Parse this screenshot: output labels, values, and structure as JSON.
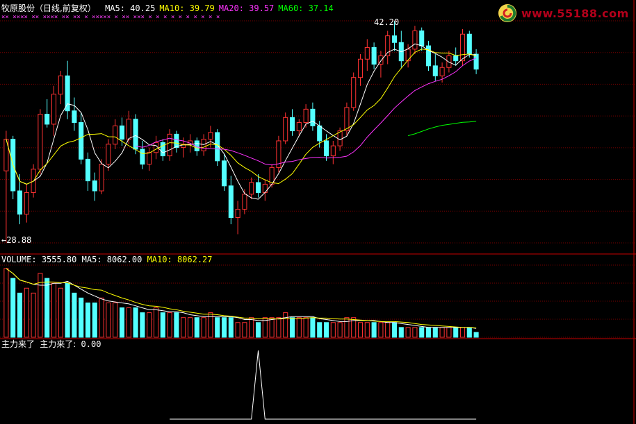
{
  "header": {
    "title": "牧原股份（日线,前复权）",
    "ma_items": [
      {
        "label": "MA5:",
        "value": "40.25",
        "color": "#ffffff"
      },
      {
        "label": "MA10:",
        "value": "39.79",
        "color": "#ffff00"
      },
      {
        "label": "MA20:",
        "value": "39.57",
        "color": "#ff33ff"
      },
      {
        "label": "MA60:",
        "value": "37.14",
        "color": "#00ff00"
      }
    ]
  },
  "logo": {
    "text": "www.55188.com"
  },
  "price_panel": {
    "high_marker": "42.20",
    "low_marker": "28.88",
    "x_markers": "××  ××××    ××  ××××      ××    ××    ×   ×××××    ×   ××  ×××  ×   ×    ×   ×   ×  ×   ×   ×   ×   ×"
  },
  "volume_panel": {
    "label": "VOLUME:",
    "value": "3555.80",
    "ma5_label": "MA5:",
    "ma5_value": "8062.00",
    "ma10_label": "MA10:",
    "ma10_value": "8062.27"
  },
  "indicator_panel": {
    "label": "主力来了",
    "line_label": "主力来了:",
    "value": "0.00"
  },
  "colors": {
    "up": "#ff3232",
    "down": "#54ffff",
    "grid": "#7a0000",
    "divider": "#c80000",
    "ma5": "#ffffff",
    "ma10": "#ffff00",
    "ma20": "#ff33ff",
    "ma60": "#00ff00"
  },
  "chart_data": {
    "type": "candlestick",
    "y_range": [
      28.88,
      42.2
    ],
    "ohlc": [
      [
        33.2,
        35.6,
        28.9,
        35.1
      ],
      [
        35.1,
        35.3,
        31.5,
        32.0
      ],
      [
        32.0,
        33.0,
        30.0,
        30.6
      ],
      [
        30.6,
        32.4,
        30.1,
        31.9
      ],
      [
        31.9,
        33.6,
        31.6,
        33.3
      ],
      [
        33.3,
        36.9,
        33.0,
        36.6
      ],
      [
        36.6,
        37.5,
        35.8,
        36.0
      ],
      [
        36.0,
        38.3,
        35.3,
        37.8
      ],
      [
        37.8,
        39.2,
        37.2,
        38.9
      ],
      [
        38.9,
        39.8,
        36.3,
        36.8
      ],
      [
        36.8,
        37.6,
        35.6,
        36.1
      ],
      [
        36.1,
        36.7,
        33.6,
        33.9
      ],
      [
        33.9,
        34.3,
        32.0,
        32.6
      ],
      [
        32.6,
        33.1,
        31.4,
        32.0
      ],
      [
        32.0,
        33.9,
        31.8,
        33.6
      ],
      [
        33.6,
        35.1,
        33.2,
        34.8
      ],
      [
        34.8,
        36.3,
        34.5,
        35.9
      ],
      [
        35.9,
        36.4,
        34.7,
        35.1
      ],
      [
        35.1,
        36.8,
        34.8,
        36.3
      ],
      [
        36.3,
        36.6,
        34.2,
        34.5
      ],
      [
        34.5,
        35.0,
        33.3,
        33.6
      ],
      [
        33.6,
        34.6,
        33.2,
        34.3
      ],
      [
        34.3,
        35.3,
        33.9,
        34.9
      ],
      [
        34.9,
        35.1,
        33.8,
        34.1
      ],
      [
        34.1,
        35.7,
        33.8,
        35.4
      ],
      [
        35.4,
        35.6,
        34.3,
        34.6
      ],
      [
        34.6,
        35.2,
        34.0,
        34.8
      ],
      [
        34.8,
        35.4,
        34.3,
        35.0
      ],
      [
        35.0,
        35.2,
        34.1,
        34.4
      ],
      [
        34.4,
        35.4,
        34.1,
        35.1
      ],
      [
        35.1,
        35.9,
        34.6,
        35.5
      ],
      [
        35.5,
        35.7,
        33.5,
        33.8
      ],
      [
        33.8,
        34.2,
        32.0,
        32.3
      ],
      [
        32.3,
        32.9,
        30.0,
        30.4
      ],
      [
        30.4,
        31.4,
        29.4,
        30.9
      ],
      [
        30.9,
        32.1,
        30.6,
        31.8
      ],
      [
        31.8,
        32.8,
        31.5,
        32.5
      ],
      [
        32.5,
        33.0,
        31.6,
        31.9
      ],
      [
        31.9,
        32.7,
        31.4,
        32.4
      ],
      [
        32.4,
        33.6,
        32.2,
        33.4
      ],
      [
        33.4,
        35.3,
        33.1,
        35.0
      ],
      [
        35.0,
        36.7,
        34.8,
        36.4
      ],
      [
        36.4,
        36.9,
        35.3,
        35.6
      ],
      [
        35.6,
        36.3,
        35.3,
        36.1
      ],
      [
        36.1,
        37.2,
        35.8,
        36.9
      ],
      [
        36.9,
        37.3,
        35.6,
        35.9
      ],
      [
        35.9,
        36.2,
        34.6,
        35.0
      ],
      [
        35.0,
        35.4,
        33.8,
        34.1
      ],
      [
        34.1,
        35.0,
        33.6,
        34.7
      ],
      [
        34.7,
        35.8,
        34.4,
        35.6
      ],
      [
        35.6,
        37.3,
        35.3,
        37.0
      ],
      [
        37.0,
        39.1,
        36.8,
        38.8
      ],
      [
        38.8,
        40.2,
        38.3,
        39.9
      ],
      [
        39.9,
        41.1,
        39.2,
        40.6
      ],
      [
        40.6,
        40.9,
        39.3,
        39.6
      ],
      [
        39.6,
        40.4,
        38.8,
        40.1
      ],
      [
        40.1,
        41.6,
        39.6,
        41.3
      ],
      [
        41.3,
        42.2,
        40.4,
        40.9
      ],
      [
        40.9,
        41.6,
        39.4,
        39.8
      ],
      [
        39.8,
        40.8,
        39.4,
        40.5
      ],
      [
        40.5,
        41.9,
        40.2,
        41.6
      ],
      [
        41.6,
        41.8,
        40.4,
        40.7
      ],
      [
        40.7,
        41.0,
        39.2,
        39.5
      ],
      [
        39.5,
        40.2,
        38.6,
        38.9
      ],
      [
        38.9,
        39.7,
        38.5,
        39.4
      ],
      [
        39.4,
        40.4,
        39.1,
        40.1
      ],
      [
        40.1,
        40.6,
        39.5,
        39.8
      ],
      [
        39.8,
        41.7,
        39.5,
        41.4
      ],
      [
        41.4,
        41.6,
        40.0,
        40.2
      ],
      [
        40.2,
        40.5,
        39.0,
        39.3
      ]
    ],
    "volume": [
      14,
      12,
      9,
      10,
      9,
      13,
      12,
      11,
      10,
      11,
      9,
      8,
      7,
      7,
      8,
      7,
      7,
      6,
      6,
      6,
      5,
      5,
      6,
      5,
      5,
      5,
      4,
      4,
      4,
      4,
      5,
      4,
      4,
      4,
      3,
      3,
      4,
      3,
      4,
      4,
      4,
      5,
      4,
      4,
      4,
      4,
      3,
      3,
      3,
      3,
      4,
      4,
      3,
      3,
      3,
      3,
      3,
      3,
      2,
      2,
      2,
      2,
      2,
      2,
      2,
      2,
      2,
      2,
      2,
      1
    ],
    "indicator_spike_index": 37,
    "indicator_range": [
      0,
      1
    ]
  }
}
